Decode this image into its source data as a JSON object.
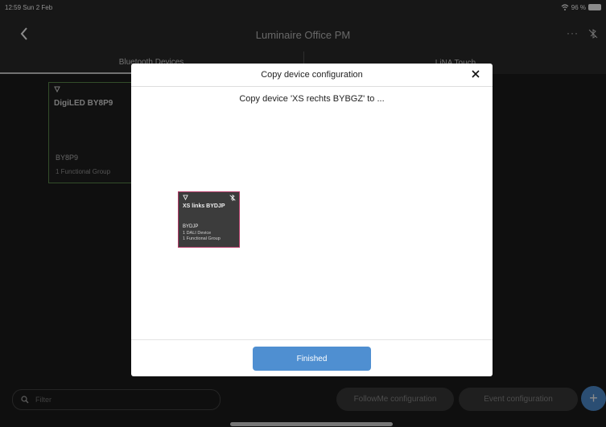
{
  "status_bar": {
    "time": "12:59  Sun 2 Feb",
    "battery": "96 %"
  },
  "nav": {
    "title": "Luminaire Office PM",
    "more": "···"
  },
  "tabs": [
    {
      "label": "Bluetooth Devices"
    },
    {
      "label": "LiNA Touch"
    }
  ],
  "background_device": {
    "name": "DigiLED BY8P9",
    "code": "BY8P9",
    "group": "1 Functional Group"
  },
  "modal": {
    "title": "Copy device configuration",
    "subtitle": "Copy device 'XS rechts BYBGZ' to ...",
    "device": {
      "name": "XS links BYDJP",
      "code": "BYDJP",
      "dali": "1 DALI Device",
      "group": "1 Functional Group"
    },
    "finished_label": "Finished"
  },
  "bottom": {
    "filter_placeholder": "Filter",
    "followme_label": "FollowMe configuration",
    "event_label": "Event configuration",
    "add_label": "+"
  },
  "colors": {
    "accent": "#4f8fd1",
    "device_border": "#b23a66",
    "background_card_border": "#5d8d4d"
  }
}
